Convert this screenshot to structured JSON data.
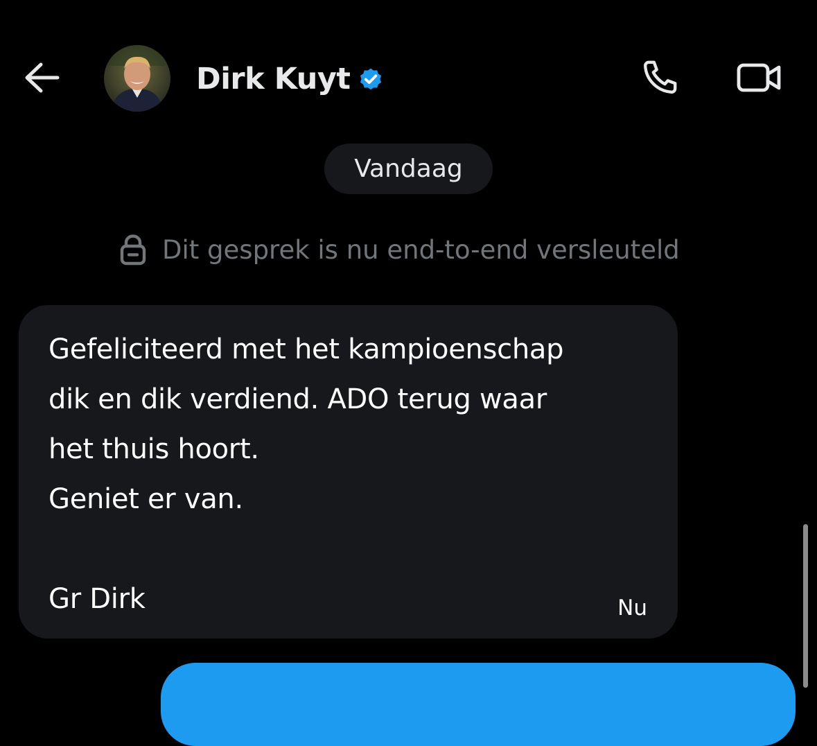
{
  "header": {
    "contact_name": "Dirk Kuyt",
    "verified": true,
    "accent_color": "#1d9bf0"
  },
  "icons": {
    "back": "arrow-left-icon",
    "verified": "verified-badge-icon",
    "call": "phone-icon",
    "video": "video-camera-icon",
    "lock": "lock-icon"
  },
  "conversation": {
    "date_separator": "Vandaag",
    "encryption_notice": "Dit gesprek is nu end-to-end versleuteld",
    "messages": [
      {
        "direction": "incoming",
        "text": "Gefeliciteerd met het kampioenschap\ndik en dik verdiend. ADO terug waar\nhet thuis hoort.\nGeniet er van.\n\nGr Dirk",
        "time": "Nu"
      },
      {
        "direction": "outgoing",
        "text": ""
      }
    ]
  },
  "colors": {
    "background": "#000000",
    "incoming_bubble": "#16181c",
    "outgoing_bubble": "#1d9bf0",
    "muted_text": "#71767b"
  }
}
